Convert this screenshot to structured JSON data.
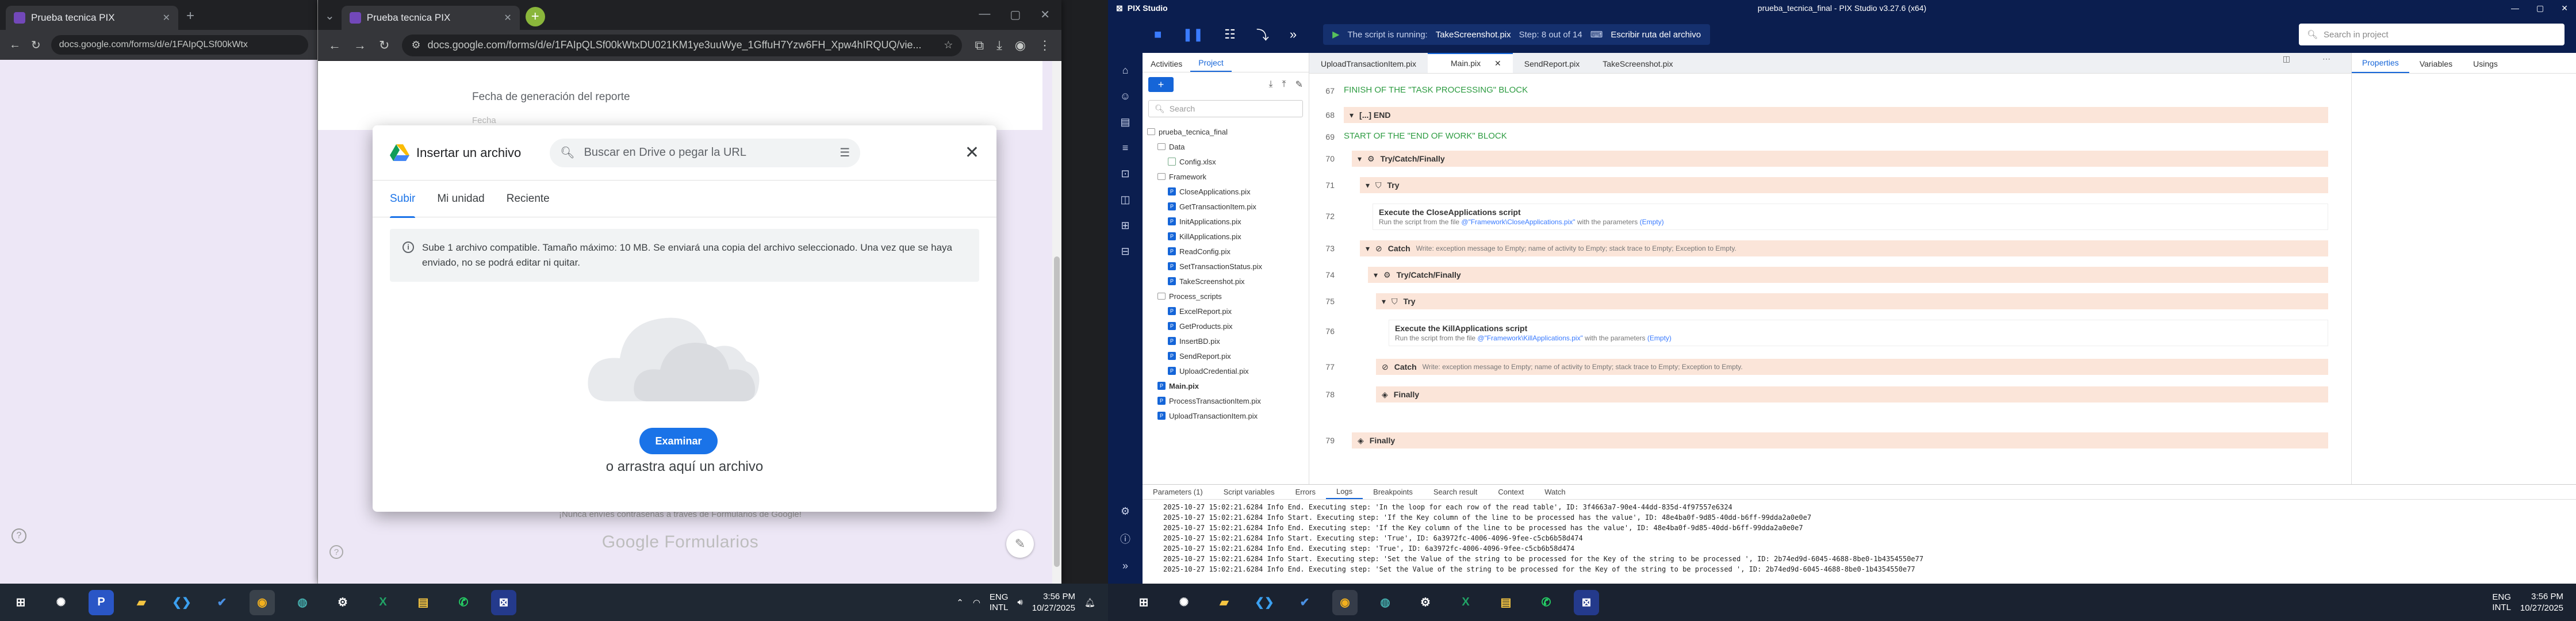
{
  "chrome_back": {
    "tab_title": "Prueba tecnica PIX",
    "url": "docs.google.com/forms/d/e/1FAIpQLSf00kWtx"
  },
  "chrome": {
    "tab_title": "Prueba tecnica PIX",
    "url": "docs.google.com/forms/d/e/1FAIpQLSf00kWtxDU021KM1ye3uuWye_1GffuH7Yzw6FH_Xpw4hIRQUQ/vie...",
    "form": {
      "question": "Fecha de generación del reporte",
      "placeholder": "Fecha",
      "warning": "¡Nunca envíes contraseñas a través de Formularios de Google!",
      "brand": "Google Formularios"
    }
  },
  "dialog": {
    "title": "Insertar un archivo",
    "search_placeholder": "Buscar en Drive o pegar la URL",
    "tabs": [
      "Subir",
      "Mi unidad",
      "Reciente"
    ],
    "info": "Sube 1 archivo compatible. Tamaño máximo: 10 MB. Se enviará una copia del archivo seleccionado. Una vez que se haya enviado, no se podrá editar ni quitar.",
    "browse_label": "Examinar",
    "drag_text": "o arrastra aquí un archivo"
  },
  "taskbar_left": {
    "lang": "ENG",
    "layout": "INTL",
    "time": "3:56 PM",
    "date": "10/27/2025"
  },
  "taskbar_right": {
    "lang": "ENG",
    "layout": "INTL",
    "time": "3:56 PM",
    "date": "10/27/2025"
  },
  "pix": {
    "app_name": "PIX Studio",
    "window_title": "prueba_tecnica_final - PIX Studio v3.27.6 (x64)",
    "status_running": "The script is running:",
    "status_script": "TakeScreenshot.pix",
    "status_step": "Step: 8 out of 14",
    "status_action": "Escribir ruta del archivo",
    "search_placeholder": "Search in project",
    "side_tabs": [
      "Activities",
      "Project"
    ],
    "project_search": "Search",
    "tree": [
      {
        "label": "prueba_tecnica_final",
        "kind": "folder",
        "indent": 0
      },
      {
        "label": "Data",
        "kind": "folder",
        "indent": 1
      },
      {
        "label": "Config.xlsx",
        "kind": "cfg",
        "indent": 2
      },
      {
        "label": "Framework",
        "kind": "folder",
        "indent": 1
      },
      {
        "label": "CloseApplications.pix",
        "kind": "pix",
        "indent": 2
      },
      {
        "label": "GetTransactionItem.pix",
        "kind": "pix",
        "indent": 2
      },
      {
        "label": "InitApplications.pix",
        "kind": "pix",
        "indent": 2
      },
      {
        "label": "KillApplications.pix",
        "kind": "pix",
        "indent": 2
      },
      {
        "label": "ReadConfig.pix",
        "kind": "pix",
        "indent": 2
      },
      {
        "label": "SetTransactionStatus.pix",
        "kind": "pix",
        "indent": 2
      },
      {
        "label": "TakeScreenshot.pix",
        "kind": "pix",
        "indent": 2
      },
      {
        "label": "Process_scripts",
        "kind": "folder",
        "indent": 1
      },
      {
        "label": "ExcelReport.pix",
        "kind": "pix",
        "indent": 2
      },
      {
        "label": "GetProducts.pix",
        "kind": "pix",
        "indent": 2
      },
      {
        "label": "InsertBD.pix",
        "kind": "pix",
        "indent": 2
      },
      {
        "label": "SendReport.pix",
        "kind": "pix",
        "indent": 2
      },
      {
        "label": "UploadCredential.pix",
        "kind": "pix",
        "indent": 2
      },
      {
        "label": "Main.pix",
        "kind": "pix",
        "indent": 1,
        "bold": true
      },
      {
        "label": "ProcessTransactionItem.pix",
        "kind": "pix",
        "indent": 1
      },
      {
        "label": "UploadTransactionItem.pix",
        "kind": "pix",
        "indent": 1
      }
    ],
    "editor_tabs": [
      "UploadTransactionItem.pix",
      "Main.pix",
      "SendReport.pix",
      "TakeScreenshot.pix"
    ],
    "right_tabs": [
      "Properties",
      "Variables",
      "Usings"
    ],
    "bottom_tabs": [
      "Parameters (1)",
      "Script variables",
      "Errors",
      "Logs",
      "Breakpoints",
      "Search result",
      "Context",
      "Watch"
    ],
    "lines": {
      "l67": "67",
      "l68": "68",
      "l69": "69",
      "l70": "70",
      "l71": "71",
      "l72": "72",
      "l73": "73",
      "l74": "74",
      "l75": "75",
      "l76": "76",
      "l77": "77",
      "l78": "78",
      "l79": "79"
    },
    "code": {
      "c67": "FINISH OF THE \"TASK PROCESSING\" BLOCK",
      "c68": "[...] END",
      "c69": "START OF THE \"END OF WORK\" BLOCK",
      "c70": "Try/Catch/Finally",
      "c71": "Try",
      "c72_title": "Execute the CloseApplications script",
      "c72_sub_a": "Run the script from the file",
      "c72_sub_path": "@\"Framework\\CloseApplications.pix\"",
      "c72_sub_b": "with the parameters",
      "c72_sub_empty": "(Empty)",
      "c73_label": "Catch",
      "c73_text": "Write: exception message to Empty; name of activity to Empty; stack trace to Empty; Exception to Empty.",
      "c74": "Try/Catch/Finally",
      "c75": "Try",
      "c76_title": "Execute the KillApplications script",
      "c76_sub_a": "Run the script from the file",
      "c76_sub_path": "@\"Framework\\KillApplications.pix\"",
      "c76_sub_b": "with the parameters",
      "c76_sub_empty": "(Empty)",
      "c77_label": "Catch",
      "c77_text": "Write: exception message to Empty; name of activity to Empty; stack trace to Empty; Exception to Empty.",
      "c78": "Finally",
      "c79": "Finally"
    },
    "logs": [
      "2025-10-27 15:02:21.6284 Info End. Executing step: 'In the loop for each row of the read table', ID: 3f4663a7-90e4-44dd-835d-4f97557e6324",
      "2025-10-27 15:02:21.6284 Info Start. Executing step: 'If the Key column of the line to be processed has the value', ID: 48e4ba0f-9d85-40dd-b6ff-99dda2a0e0e7",
      "2025-10-27 15:02:21.6284 Info End. Executing step: 'If the Key column of the line to be processed has the value', ID: 48e4ba0f-9d85-40dd-b6ff-99dda2a0e0e7",
      "2025-10-27 15:02:21.6284 Info Start. Executing step: 'True', ID: 6a3972fc-4006-4096-9fee-c5cb6b58d474",
      "2025-10-27 15:02:21.6284 Info End. Executing step: 'True', ID: 6a3972fc-4006-4096-9fee-c5cb6b58d474",
      "2025-10-27 15:02:21.6284 Info Start. Executing step: 'Set the Value of the string to be processed for the Key of the string to be processed ', ID: 2b74ed9d-6045-4688-8be0-1b4354550e77",
      "2025-10-27 15:02:21.6284 Info End. Executing step: 'Set the Value of the string to be processed for the Key of the string to be processed ', ID: 2b74ed9d-6045-4688-8be0-1b4354550e77"
    ]
  }
}
